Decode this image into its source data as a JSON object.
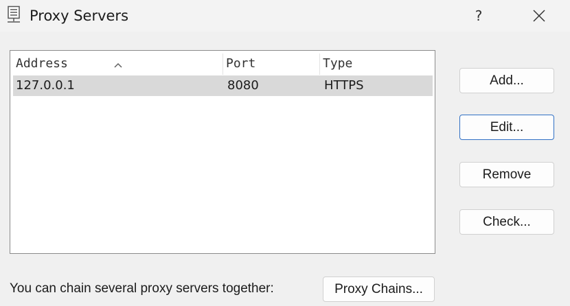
{
  "window": {
    "title": "Proxy Servers",
    "help_label": "?",
    "icon": "server-icon",
    "close_icon": "close-icon"
  },
  "list": {
    "columns": [
      "Address",
      "Port",
      "Type"
    ],
    "sort_column": "Address",
    "sort_icon": "sort-ascending-icon",
    "rows": [
      {
        "address": "127.0.0.1",
        "port": "8080",
        "type": "HTTPS"
      }
    ]
  },
  "buttons": {
    "add": "Add...",
    "edit": "Edit...",
    "remove": "Remove",
    "check": "Check...",
    "proxy_chains": "Proxy Chains..."
  },
  "footer": {
    "label": "You can chain several proxy servers together:"
  },
  "colors": {
    "selected_row": "#d9d9d9",
    "focus_border": "#2f6fc4",
    "background": "#f0f0f0"
  }
}
